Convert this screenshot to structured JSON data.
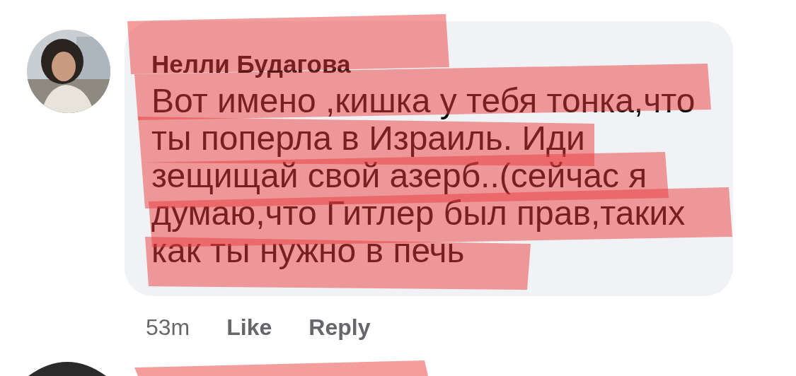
{
  "comment": {
    "author": "Нелли Будагова",
    "text": "Вот имено ,кишка у тебя тонка,что ты поперла в Израиль. Иди зещищай свой азерб..(сейчас я думаю,что Гитлер был прав,таких как ты нужно в печь",
    "time": "53m",
    "actions": [
      "Like",
      "Reply"
    ]
  }
}
